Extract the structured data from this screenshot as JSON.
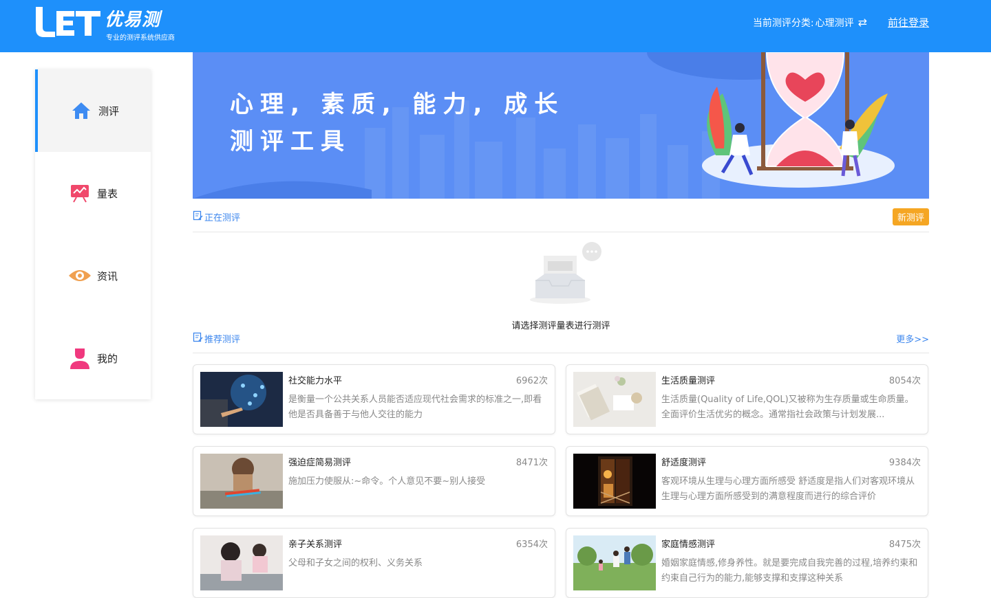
{
  "header": {
    "brand_name": "优易测",
    "slogan": "专业的测评系统供应商",
    "category_label": "当前测评分类:",
    "category_value": "心理测评",
    "login_label": "前往登录",
    "accent_color": "#1e90fb"
  },
  "sidebar": {
    "items": [
      {
        "label": "测评",
        "icon": "home-icon"
      },
      {
        "label": "量表",
        "icon": "chart-board-icon"
      },
      {
        "label": "资讯",
        "icon": "eye-icon"
      },
      {
        "label": "我的",
        "icon": "user-icon"
      }
    ]
  },
  "banner": {
    "line1": "心理, 素质, 能力, 成长",
    "line2": "测评工具"
  },
  "current": {
    "title": "正在测评",
    "new_button": "新测评",
    "empty_text": "请选择测评量表进行测评"
  },
  "recommend": {
    "title": "推荐测评",
    "more_label": "更多>>",
    "cards": [
      {
        "title": "社交能力水平",
        "count": "6962次",
        "desc": "是衡量一个公共关系人员能否适应现代社会需求的标准之一,即看他是否具备善于与他人交往的能力"
      },
      {
        "title": "生活质量测评",
        "count": "8054次",
        "desc": "生活质量(Quality of Life,QOL)又被称为生存质量或生命质量。全面评价生活优劣的概念。通常指社会政策与计划发展..."
      },
      {
        "title": "强迫症简易测评",
        "count": "8471次",
        "desc": "施加压力使服从:~命令。个人意见不要~别人接受"
      },
      {
        "title": "舒适度测评",
        "count": "9384次",
        "desc": "客观环境从生理与心理方面所感受 舒适度是指人们对客观环境从生理与心理方面所感受到的满意程度而进行的综合评价"
      },
      {
        "title": "亲子关系测评",
        "count": "6354次",
        "desc": "父母和子女之间的权利、义务关系"
      },
      {
        "title": "家庭情感测评",
        "count": "8475次",
        "desc": "婚姻家庭情感,修身养性。就是要完成自我完善的过程,培养约束和约束自己行为的能力,能够支撑和支撑这种关系"
      }
    ]
  }
}
